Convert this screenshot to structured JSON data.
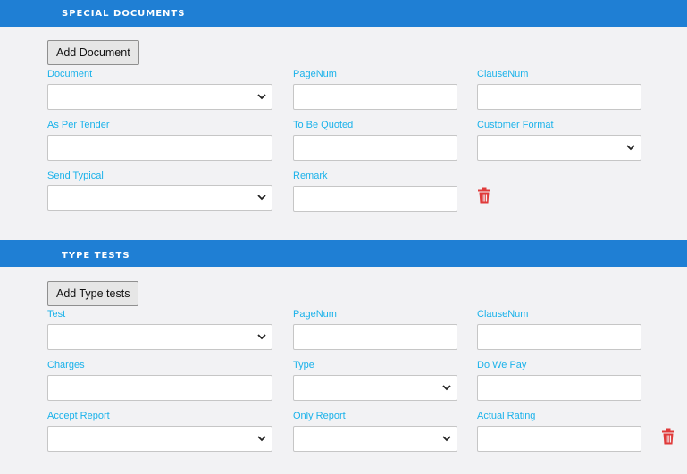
{
  "special_documents": {
    "title": "SPECIAL DOCUMENTS",
    "add_button": "Add Document",
    "labels": {
      "document": "Document",
      "page_num": "PageNum",
      "clause_num": "ClauseNum",
      "as_per_tender": "As Per Tender",
      "to_be_quoted": "To Be Quoted",
      "customer_format": "Customer Format",
      "send_typical": "Send Typical",
      "remark": "Remark"
    }
  },
  "type_tests": {
    "title": "TYPE TESTS",
    "add_button": "Add Type tests",
    "labels": {
      "test": "Test",
      "page_num": "PageNum",
      "clause_num": "ClauseNum",
      "charges": "Charges",
      "type": "Type",
      "do_we_pay": "Do We Pay",
      "accept_report": "Accept Report",
      "only_report": "Only Report",
      "actual_rating": "Actual Rating"
    }
  },
  "colors": {
    "header_bar": "#1f7fd4",
    "label": "#1ab2ea",
    "delete_icon": "#e03a3a"
  },
  "icons": {
    "select": "chevron-down-icon",
    "delete": "trash-icon"
  }
}
